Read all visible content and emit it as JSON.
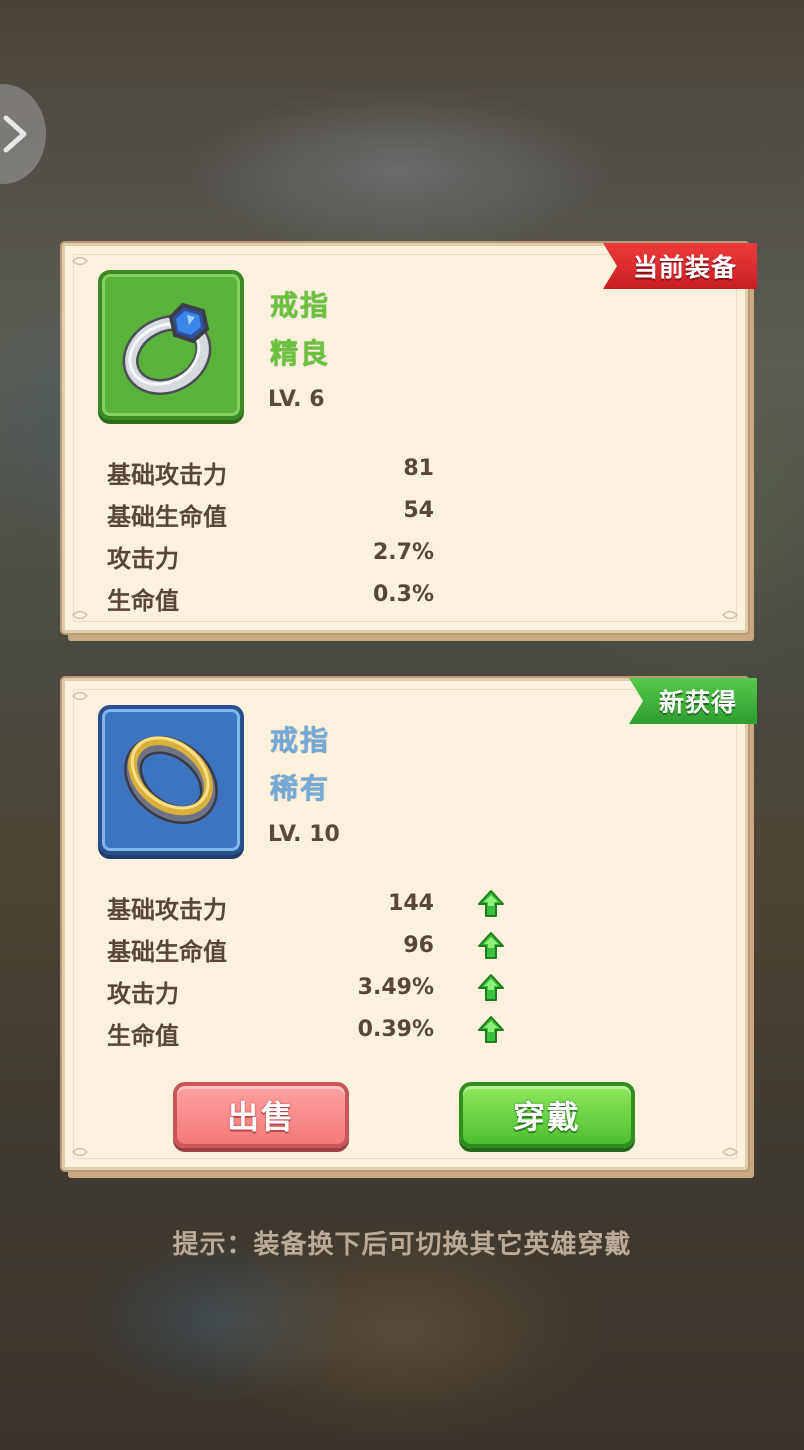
{
  "current_item": {
    "badge": "当前装备",
    "name": "戒指",
    "quality": "精良",
    "level": "LV. 6",
    "icon": "silver-ring-blue-gem-icon",
    "stats": [
      {
        "label": "基础攻击力",
        "value": "81"
      },
      {
        "label": "基础生命值",
        "value": "54"
      },
      {
        "label": "攻击力",
        "value": "2.7%"
      },
      {
        "label": "生命值",
        "value": "0.3%"
      }
    ]
  },
  "new_item": {
    "badge": "新获得",
    "name": "戒指",
    "quality": "稀有",
    "level": "LV. 10",
    "icon": "gold-ring-icon",
    "stats": [
      {
        "label": "基础攻击力",
        "value": "144",
        "trend": "up"
      },
      {
        "label": "基础生命值",
        "value": "96",
        "trend": "up"
      },
      {
        "label": "攻击力",
        "value": "3.49%",
        "trend": "up"
      },
      {
        "label": "生命值",
        "value": "0.39%",
        "trend": "up"
      }
    ],
    "sell_label": "出售",
    "equip_label": "穿戴"
  },
  "hint": "提示：装备换下后可切换其它英雄穿戴",
  "colors": {
    "uncommon": "#6ac33c",
    "rare": "#74a9d8",
    "current_badge": "#d92a2e",
    "new_badge": "#3fb33b"
  }
}
